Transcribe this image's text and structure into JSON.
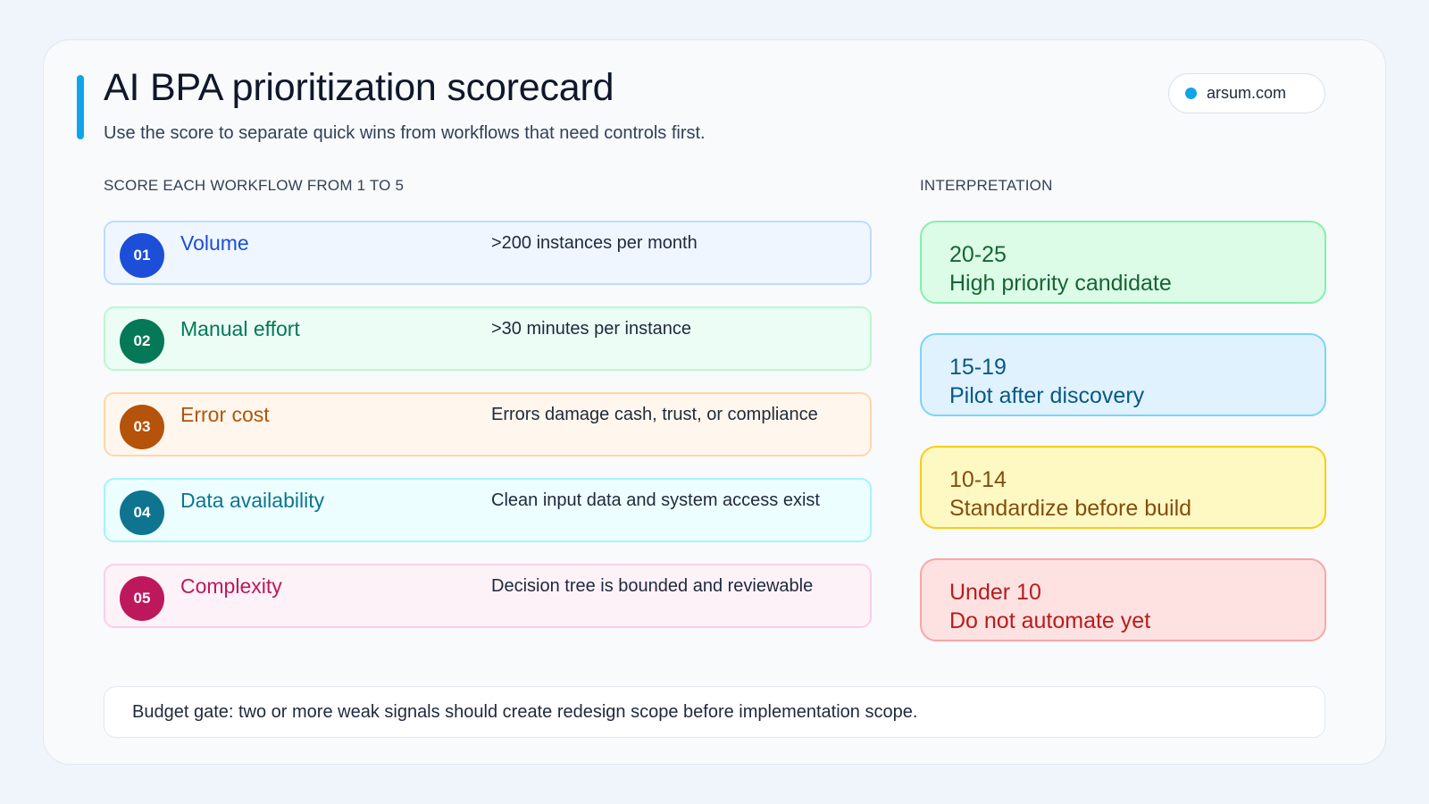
{
  "title": "AI BPA prioritization scorecard",
  "subtitle": "Use the score to separate quick wins from workflows that need controls first.",
  "domain": {
    "text": "arsum.com",
    "dot_color": "#0ea5e9"
  },
  "accent_color": "#0ea5e9",
  "criteria_label": "SCORE EACH WORKFLOW FROM 1 TO 5",
  "interpretation_label": "INTERPRETATION",
  "criteria": [
    {
      "num": "01",
      "name": "Volume",
      "desc": ">200 instances per month",
      "accent": "#1d4ed8",
      "bg": "#eff6ff",
      "border": "#bfdbfe"
    },
    {
      "num": "02",
      "name": "Manual effort",
      "desc": ">30 minutes per instance",
      "accent": "#047857",
      "bg": "#ecfdf5",
      "border": "#bbf7d0"
    },
    {
      "num": "03",
      "name": "Error cost",
      "desc": "Errors damage cash, trust, or compliance",
      "accent": "#b45309",
      "bg": "#fff7ed",
      "border": "#fed7aa"
    },
    {
      "num": "04",
      "name": "Data availability",
      "desc": "Clean input data and system access exist",
      "accent": "#0e7490",
      "bg": "#ecfeff",
      "border": "#a5f3fc"
    },
    {
      "num": "05",
      "name": "Complexity",
      "desc": "Decision tree is bounded and reviewable",
      "accent": "#be185d",
      "bg": "#fdf2f8",
      "border": "#fbcfe8"
    }
  ],
  "interpretation": [
    {
      "range": "20-25",
      "label": "High priority candidate",
      "text_color": "#166534",
      "bg": "#dcfce7",
      "border": "#86efac"
    },
    {
      "range": "15-19",
      "label": "Pilot after discovery",
      "text_color": "#075985",
      "bg": "#e0f2fe",
      "border": "#7dd3fc"
    },
    {
      "range": "10-14",
      "label": "Standardize before build",
      "text_color": "#854d0e",
      "bg": "#fef9c3",
      "border": "#facc15"
    },
    {
      "range": "Under 10",
      "label": "Do not automate yet",
      "text_color": "#b91c1c",
      "bg": "#fee2e2",
      "border": "#fca5a5"
    }
  ],
  "footer": "Budget gate: two or more weak signals should create redesign scope before implementation scope."
}
